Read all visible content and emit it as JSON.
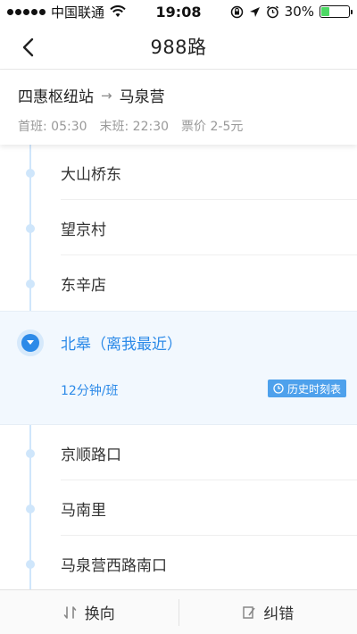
{
  "status_bar": {
    "carrier": "中国联通",
    "time": "19:08",
    "battery": "30%",
    "battery_level": 0.3
  },
  "nav": {
    "title": "988路"
  },
  "route": {
    "from": "四惠枢纽站",
    "to": "马泉营",
    "first_bus": "首班: 05:30",
    "last_bus": "末班: 22:30",
    "fare": "票价 2-5元"
  },
  "stops": {
    "before": [
      "大山桥东",
      "望京村",
      "东辛店"
    ],
    "current": {
      "name": "北皋（离我最近）",
      "frequency": "12分钟/班",
      "timetable_label": "历史时刻表"
    },
    "after": [
      "京顺路口",
      "马南里",
      "马泉营西路南口"
    ]
  },
  "bottom_bar": {
    "reverse_label": "换向",
    "report_label": "纠错"
  },
  "colors": {
    "accent": "#2c8ae8",
    "timeline": "#cfe6fb",
    "current_bg": "#f2f8fe"
  }
}
